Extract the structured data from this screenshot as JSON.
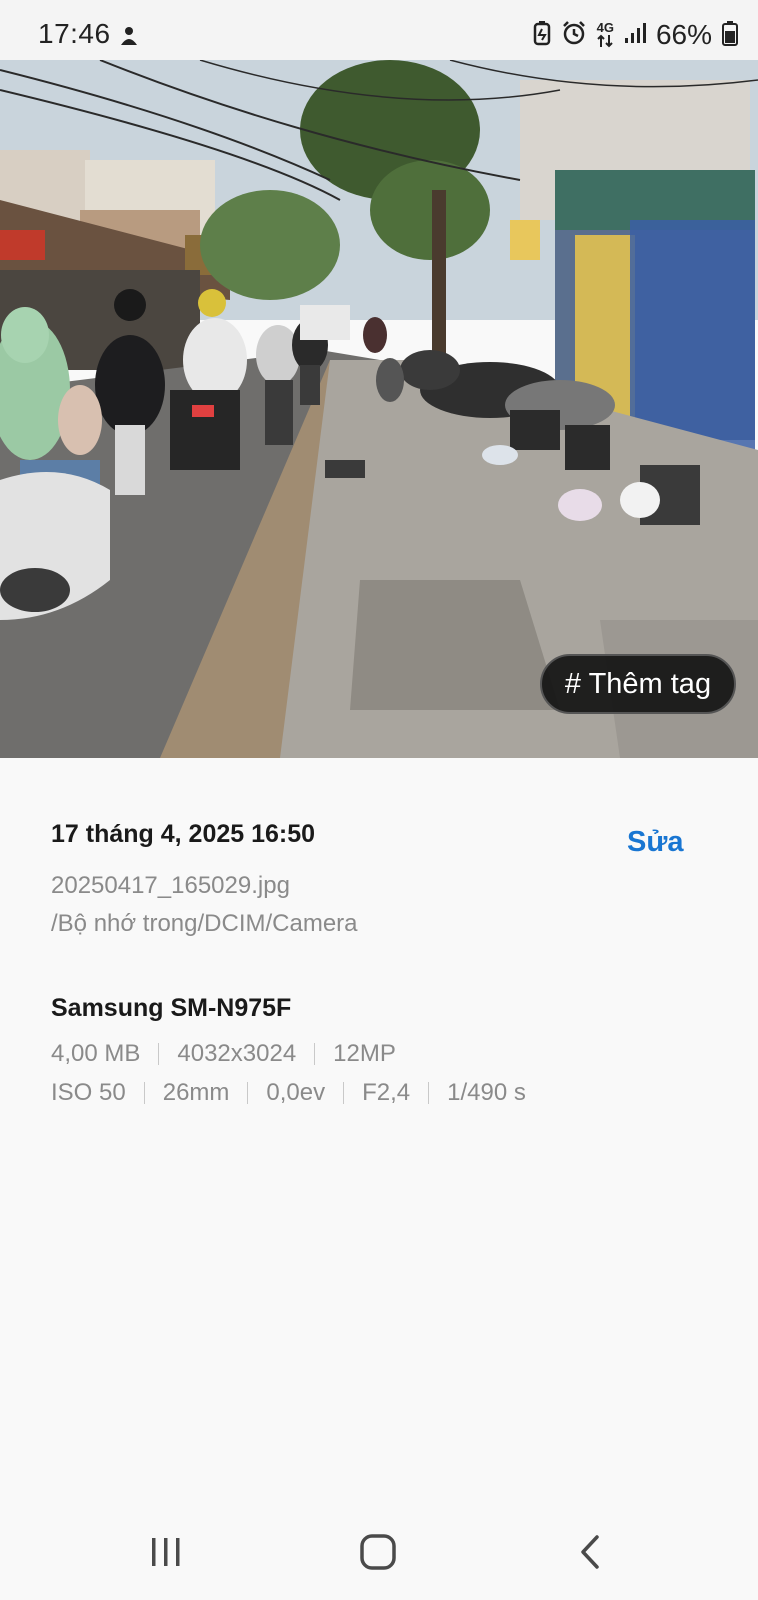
{
  "status": {
    "time": "17:46",
    "network": "4G",
    "battery": "66%",
    "icons": [
      "notification-icon",
      "battery-saver-icon",
      "alarm-icon",
      "data-arrows-icon",
      "signal-icon",
      "battery-icon"
    ]
  },
  "photo": {
    "subject": "street-scene",
    "tag_button": "# Thêm tag"
  },
  "details": {
    "date": "17 tháng 4, 2025 16:50",
    "edit": "Sửa",
    "filename": "20250417_165029.jpg",
    "path": "/Bộ nhớ trong/DCIM/Camera",
    "device": "Samsung SM-N975F",
    "size": "4,00 MB",
    "resolution": "4032x3024",
    "megapixels": "12MP",
    "iso": "ISO 50",
    "focal": "26mm",
    "ev": "0,0ev",
    "aperture": "F2,4",
    "shutter": "1/490 s"
  },
  "nav": {
    "icons": [
      "recent-apps-icon",
      "home-icon",
      "back-icon"
    ]
  },
  "colors": {
    "accent": "#1976d2",
    "background": "#f9f9f9",
    "secondary_text": "#8a8a8a"
  }
}
